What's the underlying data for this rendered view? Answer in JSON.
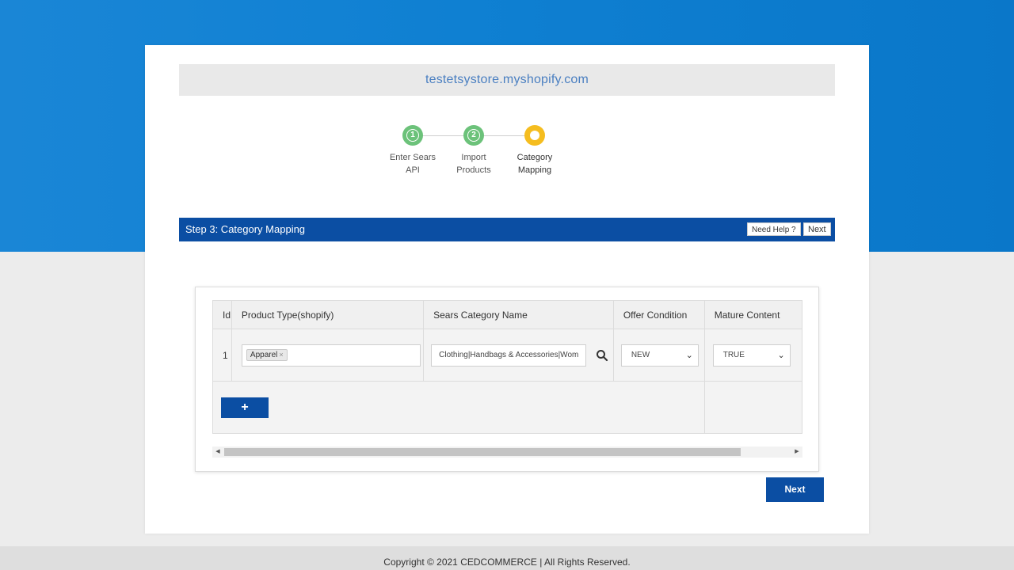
{
  "store": {
    "domain": "testetsystore.myshopify.com"
  },
  "stepper": {
    "steps": [
      {
        "number": "1",
        "label_line1": "Enter Sears",
        "label_line2": "API",
        "state": "done"
      },
      {
        "number": "2",
        "label_line1": "Import",
        "label_line2": "Products",
        "state": "done"
      },
      {
        "number": "",
        "label_line1": "Category",
        "label_line2": "Mapping",
        "state": "active"
      }
    ]
  },
  "header": {
    "title": "Step 3: Category Mapping",
    "help_label": "Need Help ?",
    "next_label": "Next"
  },
  "table": {
    "columns": [
      "Id",
      "Product Type(shopify)",
      "Sears Category Name",
      "Offer Condition",
      "Mature Content"
    ],
    "rows": [
      {
        "id": "1",
        "product_type_tag": "Apparel",
        "tag_remove": "×",
        "sears_category": "Clothing|Handbags & Accessories|Wom",
        "offer_condition": "NEW",
        "mature_content": "TRUE"
      }
    ],
    "add_button": "+"
  },
  "footer": {
    "next_label": "Next",
    "copyright": "Copyright © 2021 CEDCOMMERCE | All Rights Reserved."
  },
  "colors": {
    "primary": "#0b4ea3",
    "step_done": "#6cc27a",
    "step_active": "#f5bd1f",
    "top_background": "#0f80d2"
  }
}
